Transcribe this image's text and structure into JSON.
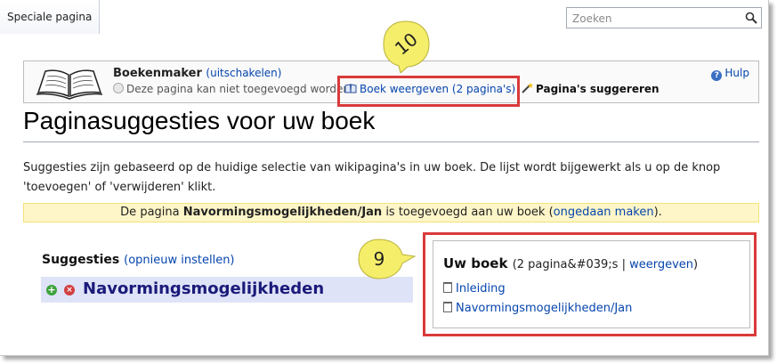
{
  "header": {
    "tab_label": "Speciale pagina",
    "search_placeholder": "Zoeken"
  },
  "bookmaker": {
    "title": "Boekenmaker",
    "disable_link": "(uitschakelen)",
    "cannot_add": "Deze pagina kan niet toegevoegd worden",
    "show_book": "Boek weergeven (2 pagina's)",
    "suggest": "Pagina's suggereren",
    "help": "Hulp"
  },
  "page": {
    "title": "Paginasuggesties voor uw boek",
    "intro_line1": "Suggesties zijn gebaseerd op de huidige selectie van wikipagina's in uw boek. De lijst wordt bijgewerkt als u op de knop",
    "intro_line2": "'toevoegen' of 'verwijderen' klikt.",
    "notice_prefix": "De pagina ",
    "notice_page": "Navormingsmogelijkheden/Jan",
    "notice_middle": " is toegevoegd aan uw boek (",
    "notice_undo": "ongedaan maken",
    "notice_suffix": ")."
  },
  "suggestions": {
    "heading": "Suggesties",
    "reset_link": "(opnieuw instellen)",
    "items": [
      {
        "title": "Navormingsmogelijkheden"
      }
    ]
  },
  "book": {
    "heading": "Uw boek",
    "meta_prefix": "(2 pagina&#039;s | ",
    "view_link": "weergeven",
    "meta_suffix": ")",
    "items": [
      {
        "title": "Inleiding"
      },
      {
        "title": "Navormingsmogelijkheden/Jan"
      }
    ]
  },
  "callouts": {
    "badge_10": "10",
    "badge_9": "9",
    "badge_color": "#f5ee6a",
    "highlight_color": "#d93a3a"
  }
}
